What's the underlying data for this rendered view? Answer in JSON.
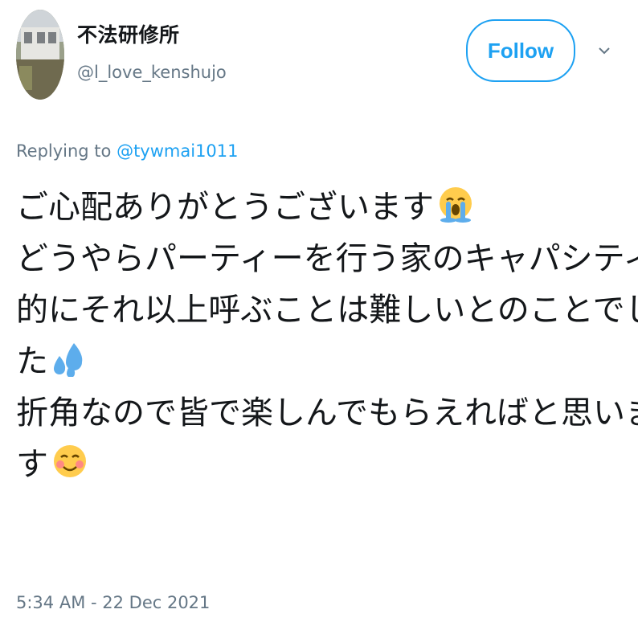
{
  "user": {
    "display_name": "不法研修所",
    "handle": "@l_love_kenshujo"
  },
  "header": {
    "follow_label": "Follow",
    "menu_icon": "chevron-down-icon"
  },
  "reply": {
    "prefix": "Replying to ",
    "target": "@tywmai1011"
  },
  "tweet": {
    "line1": "ご心配ありがとうございます",
    "line1_emoji": "loudly-crying-face-emoji",
    "line2": "どうやらパーティーを行う家のキャパシティ",
    "line3": "的にそれ以上呼ぶことは難しいとのことでし",
    "line4": "た",
    "line4_emoji": "sweat-droplets-emoji",
    "line5": "折角なので皆で楽しんでもらえればと思いま",
    "line6": "す",
    "line6_emoji": "smiling-face-emoji"
  },
  "timestamp": "5:34 AM - 22 Dec 2021",
  "colors": {
    "accent": "#1da1f2",
    "secondary_text": "#657786",
    "primary_text": "#14171a"
  }
}
